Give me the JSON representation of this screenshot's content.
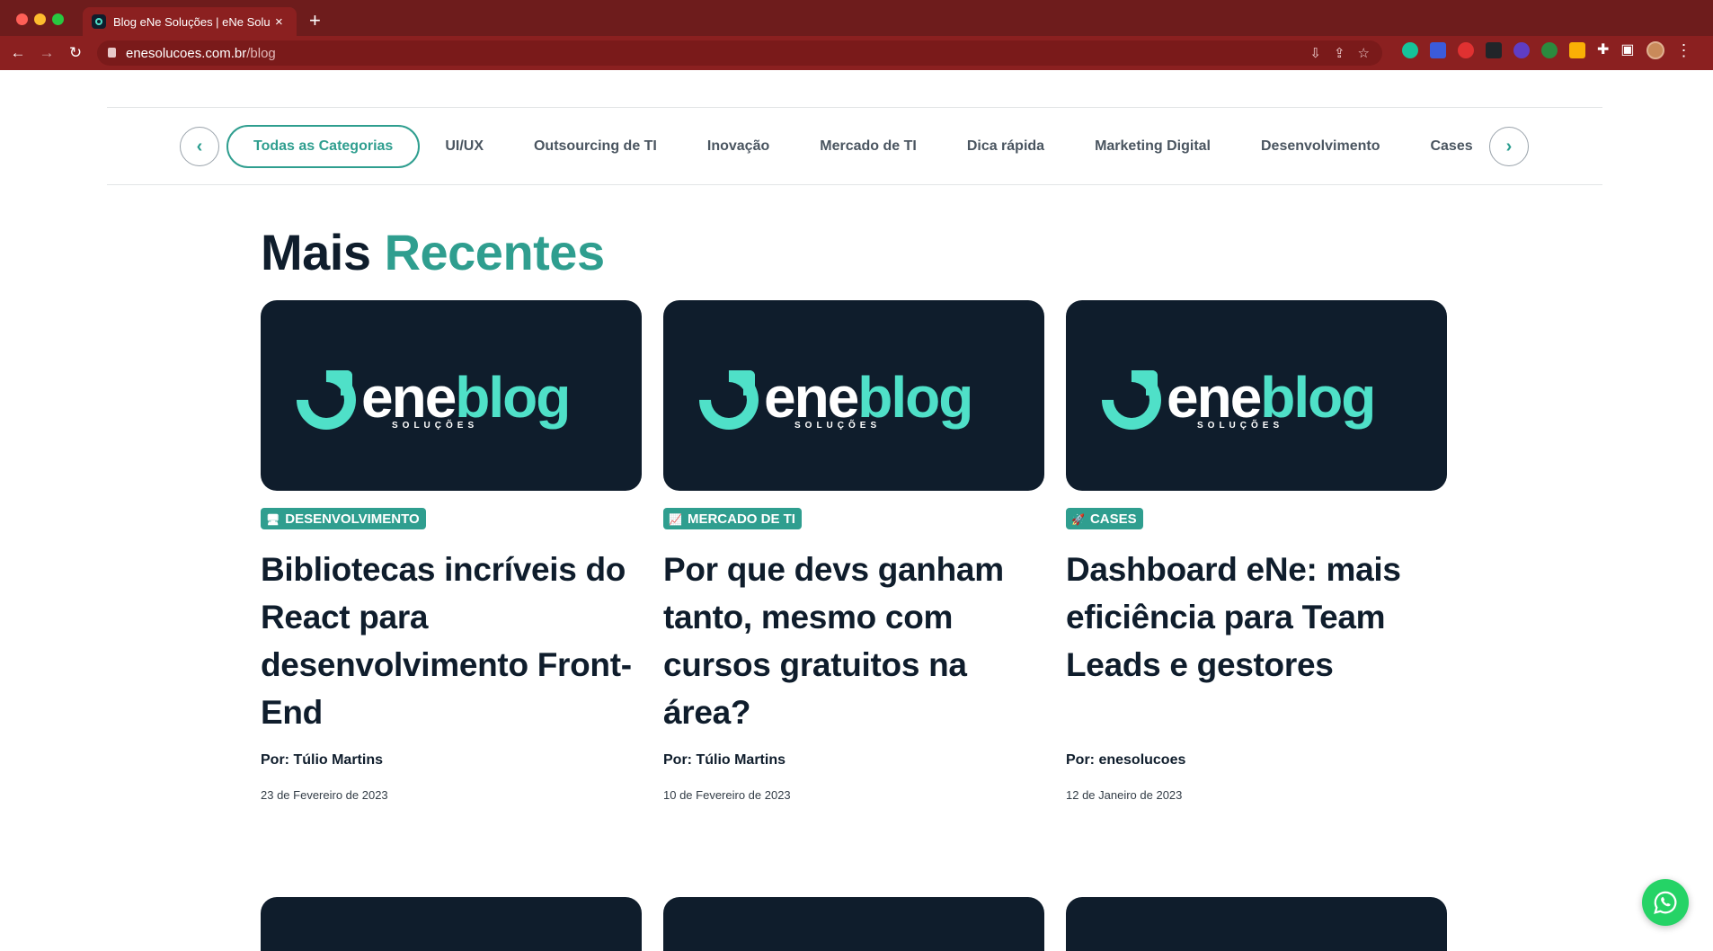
{
  "browser": {
    "tab_title": "Blog eNe Soluções | eNe Soluç",
    "tab_close": "×",
    "new_tab": "+",
    "url_domain": "enesolucoes.com.br",
    "url_path": "/blog",
    "nav": {
      "back": "←",
      "forward": "→",
      "reload": "↻"
    },
    "omnibox_icons": [
      "install-icon",
      "share-icon",
      "star-icon"
    ],
    "extensions": [
      "grammarly-icon",
      "link-icon",
      "hand-icon",
      "google-icon",
      "gear-extension-icon",
      "dollar-icon",
      "b-extension-icon",
      "puzzle-icon",
      "sidebar-icon",
      "profile-avatar",
      "menu-dots-icon"
    ]
  },
  "categories": {
    "prev_label": "‹",
    "next_label": "›",
    "items": [
      {
        "label": "Todas as Categorias",
        "active": true
      },
      {
        "label": "UI/UX"
      },
      {
        "label": "Outsourcing de TI"
      },
      {
        "label": "Inovação"
      },
      {
        "label": "Mercado de TI"
      },
      {
        "label": "Dica rápida"
      },
      {
        "label": "Marketing Digital"
      },
      {
        "label": "Desenvolvimento"
      },
      {
        "label": "Cases"
      }
    ]
  },
  "section": {
    "title_plain": "Mais",
    "title_accent": "Recentes"
  },
  "thumbnail": {
    "logo_ene": "ene",
    "logo_blog": "blog",
    "logo_sub": "SOLUÇÕES"
  },
  "posts": [
    {
      "category": "DESENVOLVIMENTO",
      "category_icon": "🖥",
      "title": "Bibliotecas incríveis do React para desenvolvimento Front-End",
      "author": "Por: Túlio Martins",
      "date": "23 de Fevereiro de 2023"
    },
    {
      "category": "MERCADO DE TI",
      "category_icon": "📈",
      "title": "Por que devs ganham tanto, mesmo com cursos gratuitos na área?",
      "author": "Por: Túlio Martins",
      "date": "10 de Fevereiro de 2023"
    },
    {
      "category": "CASES",
      "category_icon": "🚀",
      "title": "Dashboard eNe: mais eficiência para Team Leads e gestores",
      "author": "Por: enesolucoes",
      "date": "12 de Janeiro de 2023"
    }
  ],
  "colors": {
    "browser_frame": "#6e1c1c",
    "brand_navy": "#0f1d2c",
    "brand_teal": "#2f9e8f",
    "logo_mint": "#4fe0c8",
    "whatsapp_green": "#25d366"
  }
}
